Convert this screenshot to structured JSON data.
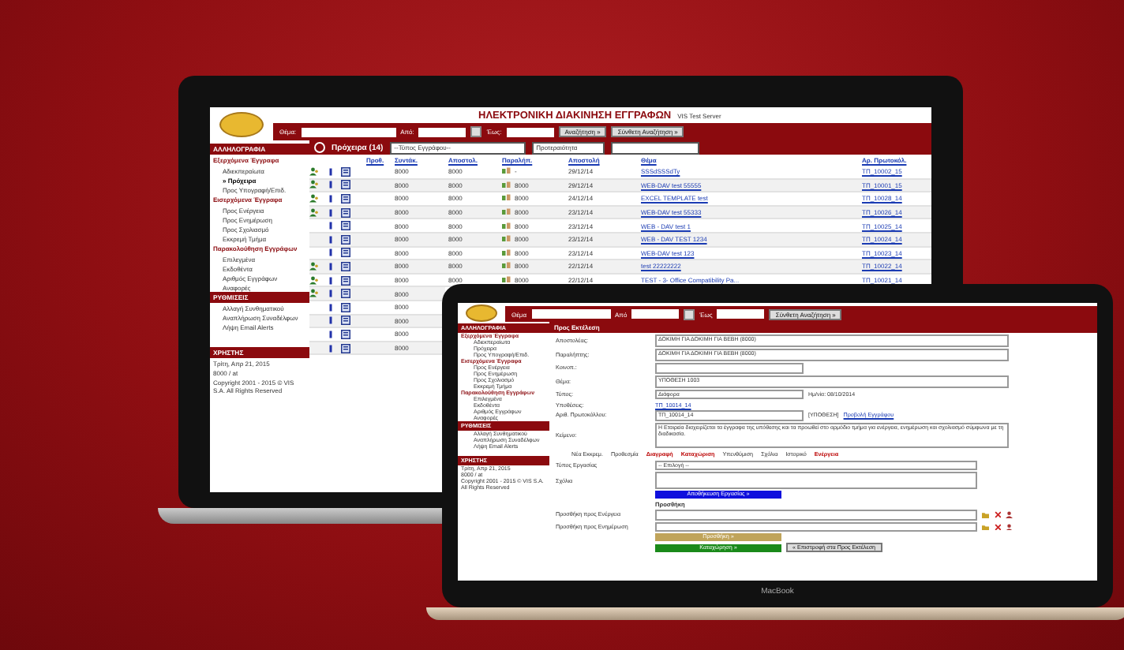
{
  "main_laptop": {
    "header": {
      "title": "ΗΛΕΚΤΡΟΝΙΚΗ ΔΙΑΚΙΝΗΣΗ ΕΓΓΡΑΦΩΝ",
      "server": "VIS Test Server",
      "subject_label": "Θέμα:",
      "from_label": "Από:",
      "to_label": "Έως:",
      "search_button": "Αναζήτηση »",
      "advanced_button": "Σύνθετη Αναζήτηση »"
    },
    "sidebar": {
      "sections": [
        {
          "kind": "header",
          "title": "ΑΛΛΗΛΟΓΡΑΦΙΑ"
        },
        {
          "kind": "group",
          "title": "Εξερχόμενα Έγγραφα",
          "items": [
            {
              "label": "Αδιεκπεραίωτα",
              "selected": false
            },
            {
              "label": "» Πρόχειρα",
              "selected": true
            },
            {
              "label": "Προς Υπογραφή/Επιδ.",
              "selected": false
            }
          ]
        },
        {
          "kind": "group",
          "title": "Εισερχόμενα Έγγραφα",
          "items": [
            {
              "label": "Προς Ενέργεια",
              "selected": false
            },
            {
              "label": "Προς Ενημέρωση",
              "selected": false
            },
            {
              "label": "Προς Σχολιασμό",
              "selected": false
            },
            {
              "label": "Εκκρεμή Τμήμα",
              "selected": false
            }
          ]
        },
        {
          "kind": "group",
          "title": "Παρακολούθηση Εγγράφων",
          "items": [
            {
              "label": "Επιλεγμένα",
              "selected": false
            },
            {
              "label": "Εκδοθέντα",
              "selected": false
            },
            {
              "label": "Αριθμός Εγγράφων",
              "selected": false
            },
            {
              "label": "Αναφορές",
              "selected": false
            }
          ]
        },
        {
          "kind": "header",
          "title": "ΡΥΘΜΙΣΕΙΣ",
          "items": [
            {
              "label": "Αλλαγή Συνθηματικού",
              "selected": false
            },
            {
              "label": "Αναπλήρωση Συναδέλφων",
              "selected": false
            },
            {
              "label": "Λήψη Email Alerts",
              "selected": false
            }
          ]
        }
      ],
      "user": {
        "title": "ΧΡΗΣΤΗΣ",
        "lines": [
          "Τρίτη, Απρ 21, 2015",
          "8000 / at",
          "Copyright 2001 - 2015 © VIS S.A. All Rights Reserved"
        ]
      }
    },
    "list": {
      "title": "Πρόχειρα (14)",
      "type_filter": "--Τύπος Εγγράφου--",
      "priority_filter": "Προτεραιότητα",
      "columns": [
        "Προθ.",
        "Συντάκ.",
        "Αποστολ.",
        "Παραλήπ.",
        "Αποστολή",
        "Θέμα",
        "Αρ. Πρωτοκόλ."
      ],
      "rows": [
        {
          "assigned": true,
          "author": "8000",
          "sender": "8000",
          "recipient": "-",
          "date": "29/12/14",
          "subject": "SSSdSSSdTy",
          "protocol": "ΤΠ_10002_15"
        },
        {
          "assigned": true,
          "author": "8000",
          "sender": "8000",
          "recipient": "8000",
          "date": "29/12/14",
          "subject": "WEB-DAV test 55555",
          "protocol": "ΤΠ_10001_15"
        },
        {
          "assigned": true,
          "author": "8000",
          "sender": "8000",
          "recipient": "8000",
          "date": "24/12/14",
          "subject": "EXCEL TEMPLATE test",
          "protocol": "ΤΠ_10028_14"
        },
        {
          "assigned": true,
          "author": "8000",
          "sender": "8000",
          "recipient": "8000",
          "date": "23/12/14",
          "subject": "WEB-DAV test 55333",
          "protocol": "ΤΠ_10026_14"
        },
        {
          "assigned": false,
          "author": "8000",
          "sender": "8000",
          "recipient": "8000",
          "date": "23/12/14",
          "subject": "WEB - DAV test 1",
          "protocol": "ΤΠ_10025_14"
        },
        {
          "assigned": false,
          "author": "8000",
          "sender": "8000",
          "recipient": "8000",
          "date": "23/12/14",
          "subject": "WEB - DAV TEST 1234",
          "protocol": "ΤΠ_10024_14"
        },
        {
          "assigned": false,
          "author": "8000",
          "sender": "8000",
          "recipient": "8000",
          "date": "23/12/14",
          "subject": "WEB-DAV test 123",
          "protocol": "ΤΠ_10023_14"
        },
        {
          "assigned": true,
          "author": "8000",
          "sender": "8000",
          "recipient": "8000",
          "date": "22/12/14",
          "subject": "test 22222222",
          "protocol": "ΤΠ_10022_14"
        },
        {
          "assigned": true,
          "author": "8000",
          "sender": "8000",
          "recipient": "8000",
          "date": "22/12/14",
          "subject": "TEST - 3- Office Compatibility Pa...",
          "protocol": "ΤΠ_10021_14"
        },
        {
          "assigned": true,
          "author": "8000"
        },
        {
          "assigned": false,
          "author": "8000"
        },
        {
          "assigned": false,
          "author": "8000"
        },
        {
          "assigned": false,
          "author": "8000"
        },
        {
          "assigned": false,
          "author": "8000"
        }
      ]
    }
  },
  "second_laptop": {
    "header": {
      "subject_label": "Θέμα",
      "from_label": "Από",
      "to_label": "Έως",
      "advanced_button": "Σύνθετη Αναζήτηση »"
    },
    "sidebar": {
      "sections": [
        {
          "kind": "header",
          "title": "ΑΛΛΗΛΟΓΡΑΦΙΑ"
        },
        {
          "kind": "group",
          "title": "Εξερχόμενα Έγγραφα",
          "items": [
            {
              "label": "Αδιεκπεραίωτα",
              "selected": false
            },
            {
              "label": "Πρόχειρα",
              "selected": false
            },
            {
              "label": "Προς Υπογραφή/Επιδ.",
              "selected": false
            }
          ]
        },
        {
          "kind": "group",
          "title": "Εισερχόμενα Έγγραφα",
          "items": [
            {
              "label": "Προς Ενέργεια",
              "selected": false
            },
            {
              "label": "Προς Ενημέρωση",
              "selected": false
            },
            {
              "label": "Προς Σχολιασμό",
              "selected": false
            },
            {
              "label": "Εκκρεμή Τμήμα",
              "selected": false
            }
          ]
        },
        {
          "kind": "group",
          "title": "Παρακολούθηση Εγγράφων",
          "items": [
            {
              "label": "Επιλεγμένα",
              "selected": false
            },
            {
              "label": "Εκδοθέντα",
              "selected": false
            },
            {
              "label": "Αριθμός Εγγράφων",
              "selected": false
            },
            {
              "label": "Αναφορές",
              "selected": false
            }
          ]
        },
        {
          "kind": "header",
          "title": "ΡΥΘΜΙΣΕΙΣ",
          "items": [
            {
              "label": "Αλλαγή Συνθηματικού",
              "selected": false
            },
            {
              "label": "Αναπλήρωση Συναδέλφων",
              "selected": false
            },
            {
              "label": "Λήψη Email Alerts",
              "selected": false
            }
          ]
        }
      ],
      "user": {
        "title": "ΧΡΗΣΤΗΣ",
        "lines": [
          "Τρίτη, Απρ 21, 2015",
          "8000 / at",
          "Copyright 2001 - 2015 © VIS S.A. All Rights Reserved"
        ]
      }
    },
    "form": {
      "title": "Προς Εκτέλεση",
      "fields": [
        {
          "kind": "textarea",
          "label": "Αποστολέας:",
          "value": "ΔΟΚΙΜΗ ΓΙΑ ΔΟΚΙΜΗ ΓΙΑ ΒΕΒΗ (8000)"
        },
        {
          "kind": "textarea",
          "label": "Παραλήπτης:",
          "value": "ΔΟΚΙΜΗ ΓΙΑ ΔΟΚΙΜΗ ΓΙΑ ΒΕΒΗ (8000)"
        },
        {
          "kind": "input",
          "label": "Κοινοπ.:"
        },
        {
          "kind": "textarea",
          "label": "Θέμα:",
          "value": "ΥΠΟΘΕΣΗ 1003"
        },
        {
          "kind": "select",
          "label": "Τύπος:",
          "value": "Διάφορα",
          "note": "Ημ/νία: 08/10/2014"
        },
        {
          "kind": "link",
          "label": "Υποθέσεις:",
          "value": "ΤΠ_10014_14"
        },
        {
          "kind": "input",
          "label": "Αριθ. Πρωτοκόλλου:",
          "value": "ΤΠ_10014_14",
          "note": "[ΥΠΟΘΕΣΗ]",
          "link": "Προβολή Εγγράφου"
        },
        {
          "kind": "textarea",
          "label": "Κείμενο:",
          "value": "Η Εταιρεία διαχειρίζεται τα έγγραφα της υπόθεσης και τα προωθεί στο αρμόδιο τμήμα για ενέργεια, ενημέρωση και σχολιασμό σύμφωνα με τη διαδικασία."
        }
      ],
      "options": [
        {
          "label": "Νέα Εκκρεμ.",
          "highlighted": false
        },
        {
          "label": "Προθεσμία",
          "highlighted": false
        },
        {
          "label": "Διαγραφή",
          "highlighted": true
        },
        {
          "label": "Καταχώριση",
          "highlighted": true
        },
        {
          "label": "Υπενθύμιση",
          "highlighted": false
        },
        {
          "label": "Σχόλια",
          "highlighted": false
        },
        {
          "label": "Ιστορικό",
          "highlighted": false
        },
        {
          "label": "Ενέργεια",
          "highlighted": true
        }
      ],
      "task_label": "Τύπος Εργασίας",
      "task_select": "-- Επιλογή --",
      "comments_label": "Σχόλια",
      "save_task": "Αποθήκευση Εργασίας »",
      "add_heading": "Προσθήκη",
      "add_rows": [
        "Προσθήκη προς Ενέργεια",
        "Προσθήκη προς Ενημέρωση"
      ],
      "add_button": "Προσθήκη »",
      "submit_button": "Καταχώρηση »",
      "back_button": "« Επιστροφή στα Προς Εκτέλεση"
    },
    "brand": "MacBook"
  }
}
